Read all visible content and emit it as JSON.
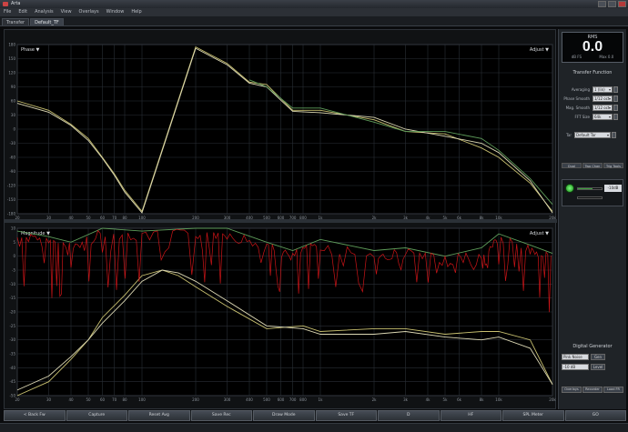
{
  "window": {
    "title": "Arta"
  },
  "menu": [
    "File",
    "Edit",
    "Analysis",
    "View",
    "Overlays",
    "Window",
    "Help"
  ],
  "tabs": [
    {
      "label": "Transfer"
    },
    {
      "label": "Default_TF"
    }
  ],
  "phase_plot": {
    "label": "Phase ▼",
    "range_label": "Adjust ▼",
    "y_ticks": [
      "180",
      "150",
      "120",
      "90",
      "60",
      "30",
      "0",
      "-30",
      "-60",
      "-90",
      "-120",
      "-150",
      "-180"
    ],
    "x_ticks": [
      "20",
      "30",
      "40",
      "50",
      "60",
      "70",
      "80",
      "100",
      "200",
      "300",
      "400",
      "500",
      "600",
      "700",
      "800",
      "1k",
      "2k",
      "3k",
      "4k",
      "5k",
      "6k",
      "8k",
      "10k",
      "20k"
    ]
  },
  "magnitude_plot": {
    "label": "Magnitude ▼",
    "range_label": "Adjust ▼",
    "y_ticks": [
      "10",
      "5",
      "0",
      "-5",
      "-10",
      "-15",
      "-20",
      "-25",
      "-30",
      "-35",
      "-40",
      "-45",
      "-50"
    ],
    "x_ticks": [
      "20",
      "30",
      "40",
      "50",
      "60",
      "70",
      "80",
      "100",
      "200",
      "300",
      "400",
      "500",
      "600",
      "700",
      "800",
      "1k",
      "2k",
      "3k",
      "4k",
      "5k",
      "6k",
      "8k",
      "10k",
      "20k"
    ]
  },
  "sidebar": {
    "meter": {
      "title": "RMS",
      "value": "0.0",
      "sub_left": "dB FS",
      "sub_right": "Max 0.0"
    },
    "transfer_title": "Transfer Function",
    "controls": [
      {
        "label": "Averaging",
        "value": "1 (lin)"
      },
      {
        "label": "Phase Smooth",
        "value": "1/12 oct"
      },
      {
        "label": "Mag. Smooth",
        "value": "1/12 oct"
      },
      {
        "label": "FFT Size",
        "value": "64k"
      }
    ],
    "delay": {
      "label": "Tar",
      "value": "Default Tar"
    },
    "tab_strip": [
      "Dual",
      "Two Chan",
      "Trig Tools"
    ],
    "generator": {
      "value": "-10dB"
    },
    "digital_title": "Digital Generator",
    "digital_rows": [
      {
        "select": "Pink Noise",
        "button": "Gen"
      },
      {
        "select": "-10 dB",
        "button": "Level"
      }
    ],
    "bottom_buttons": [
      "Overlays",
      "Recorder",
      "Load FR"
    ]
  },
  "toolbar": [
    "< Back Fw",
    "Capture",
    "Reset Avg",
    "Save Rec",
    "Draw Mode",
    "Save TF",
    "D",
    "HF",
    "SPL Meter",
    "GO"
  ],
  "colors": {
    "trace_red": "#e0161a",
    "trace_yellow": "#c8c070",
    "trace_green": "#5e9c5a",
    "trace_pale": "#dcd8b4"
  },
  "chart_data": [
    {
      "type": "line",
      "title": "Phase ▼",
      "x_scale": "log",
      "xlim": [
        20,
        20000
      ],
      "ylim": [
        -180,
        180
      ],
      "grid": true,
      "series": [
        {
          "x": [
            20,
            30,
            40,
            50,
            60,
            70,
            80,
            100,
            200,
            300,
            400,
            500,
            700,
            1000,
            2000,
            3000,
            5000,
            8000,
            10000,
            15000,
            20000
          ],
          "values": [
            60,
            40,
            10,
            -20,
            -60,
            -95,
            -130,
            -175,
            175,
            140,
            100,
            95,
            40,
            40,
            20,
            -5,
            -10,
            -40,
            -60,
            -115,
            -175
          ]
        },
        {
          "x": [
            20,
            30,
            40,
            50,
            60,
            70,
            80,
            100,
            200,
            300,
            400,
            500,
            700,
            1000,
            2000,
            3000,
            5000,
            8000,
            10000,
            15000,
            20000
          ],
          "values": [
            55,
            36,
            8,
            -24,
            -62,
            -98,
            -134,
            -178,
            172,
            137,
            98,
            90,
            38,
            35,
            25,
            0,
            -15,
            -30,
            -50,
            -110,
            -178
          ]
        },
        {
          "x": [
            400,
            500,
            700,
            1000,
            2000,
            3000,
            5000,
            8000,
            10000,
            15000,
            20000
          ],
          "values": [
            105,
            90,
            45,
            45,
            15,
            -5,
            -5,
            -20,
            -45,
            -105,
            -160
          ]
        }
      ]
    },
    {
      "type": "line",
      "title": "Magnitude ▼",
      "x_scale": "log",
      "xlim": [
        20,
        20000
      ],
      "ylim": [
        -50,
        10
      ],
      "grid": true,
      "series": [
        {
          "x": [
            20,
            30,
            40,
            50,
            60,
            80,
            100,
            130,
            160,
            200,
            300,
            500,
            800,
            1000,
            2000,
            3000,
            5000,
            8000,
            10000,
            15000,
            20000
          ],
          "values": [
            -50,
            -45,
            -37,
            -30,
            -22,
            -14,
            -7,
            -5,
            -7,
            -11,
            -18,
            -26,
            -25,
            -27,
            -26,
            -26,
            -28,
            -27,
            -27,
            -30,
            -46
          ]
        },
        {
          "x": [
            20,
            30,
            40,
            50,
            60,
            80,
            100,
            130,
            160,
            200,
            300,
            500,
            800,
            1000,
            2000,
            3000,
            5000,
            8000,
            10000,
            15000,
            20000
          ],
          "values": [
            -48,
            -43,
            -36,
            -30,
            -24,
            -16,
            -9,
            -5,
            -6,
            -9,
            -16,
            -25,
            -26,
            -28,
            -28,
            -27,
            -29,
            -30,
            -29,
            -33,
            -46
          ]
        },
        {
          "x": [
            20,
            30,
            40,
            60,
            100,
            200,
            300,
            500,
            700,
            1000,
            2000,
            3000,
            5000,
            8000,
            10000,
            15000,
            20000
          ],
          "values": [
            9,
            7,
            5,
            10,
            9,
            10,
            10,
            5,
            2,
            6,
            2,
            3,
            0,
            3,
            8,
            4,
            1
          ]
        }
      ]
    }
  ]
}
